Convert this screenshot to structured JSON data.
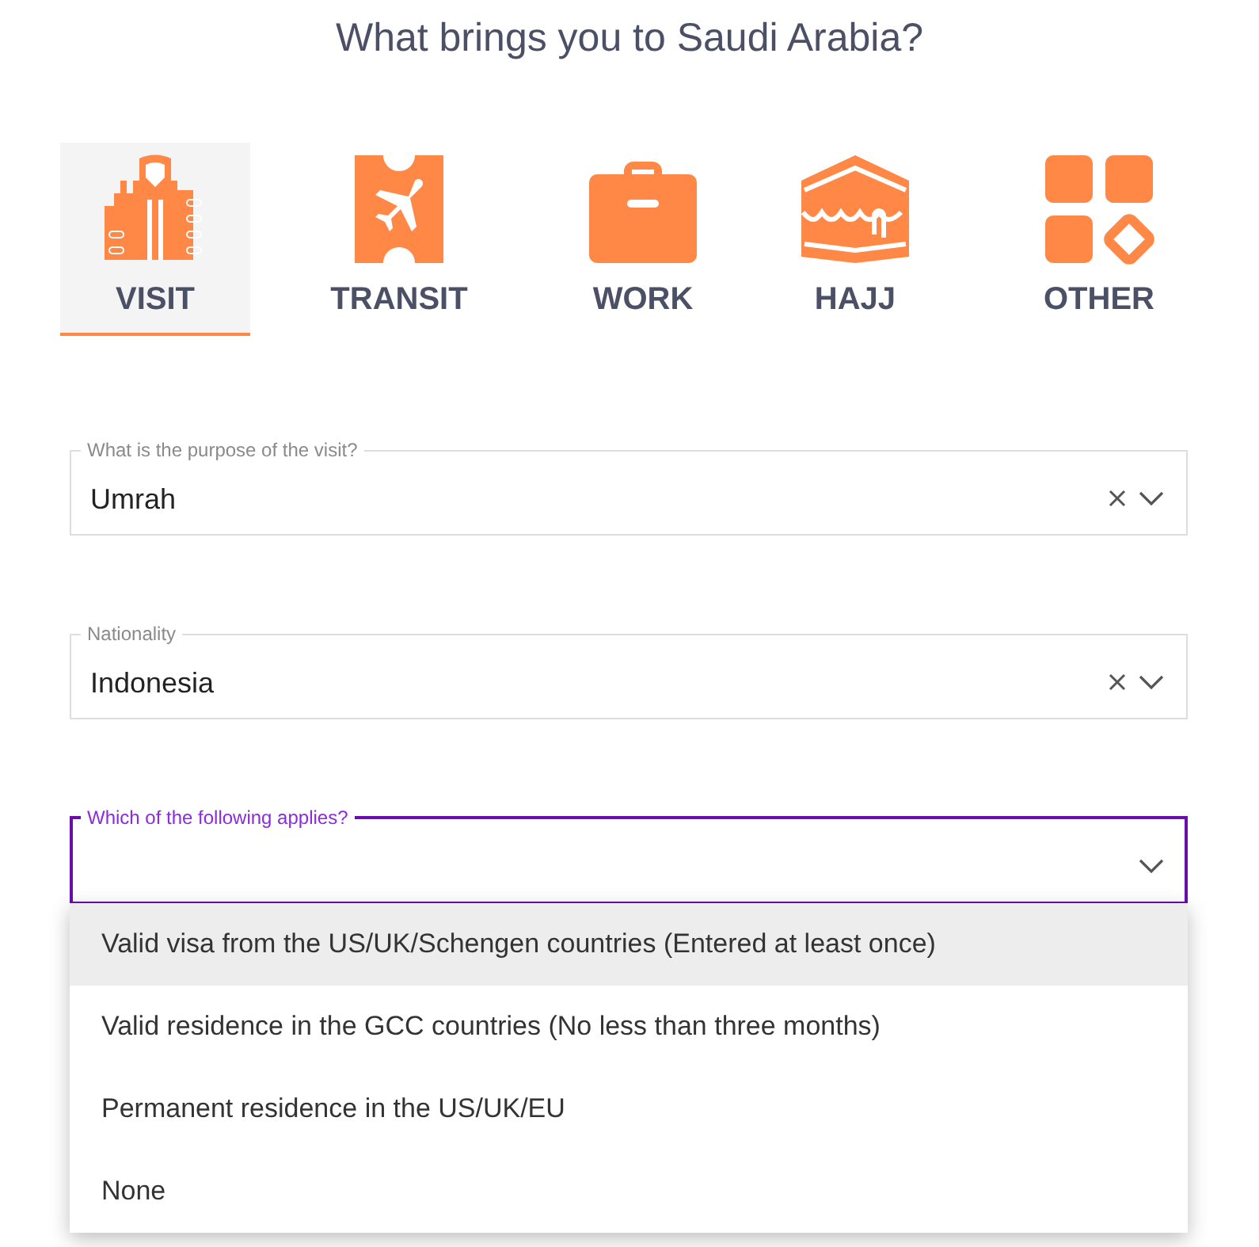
{
  "heading": "What brings you to Saudi Arabia?",
  "tabs": [
    {
      "kind": "visit",
      "label": "VISIT",
      "selected": true
    },
    {
      "kind": "transit",
      "label": "TRANSIT",
      "selected": false
    },
    {
      "kind": "work",
      "label": "WORK",
      "selected": false
    },
    {
      "kind": "hajj",
      "label": "HAJJ",
      "selected": false
    },
    {
      "kind": "other",
      "label": "OTHER",
      "selected": false
    }
  ],
  "fields": [
    {
      "label": "What is the purpose of the visit?",
      "value": "Umrah",
      "clearable": true,
      "focused": false
    },
    {
      "label": "Nationality",
      "value": "Indonesia",
      "clearable": true,
      "focused": false
    },
    {
      "label": "Which of the following applies?",
      "clearable": false,
      "focused": true
    }
  ],
  "options": [
    {
      "label": "Valid visa from the US/UK/Schengen countries (Entered at least once)",
      "highlighted": true
    },
    {
      "label": "Valid residence in the GCC countries (No less than three months)",
      "highlighted": false
    },
    {
      "label": "Permanent residence in the US/UK/EU",
      "highlighted": false
    },
    {
      "label": "None",
      "highlighted": false
    }
  ]
}
